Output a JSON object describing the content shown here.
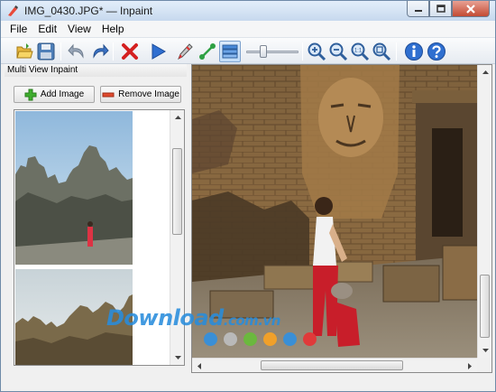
{
  "window": {
    "title": "IMG_0430.JPG* — Inpaint"
  },
  "menu": [
    "File",
    "Edit",
    "View",
    "Help"
  ],
  "toolbar": {
    "icons": [
      "open-folder-icon",
      "save-icon",
      "undo-icon",
      "redo-icon",
      "delete-icon",
      "run-icon",
      "marker-icon",
      "line-tool-icon",
      "multi-view-icon",
      "zoom-in-icon",
      "zoom-out-icon",
      "actual-size-icon",
      "fit-window-icon",
      "info-icon",
      "help-icon"
    ],
    "brush_size_fraction": 0.3
  },
  "panel": {
    "title": "Multi View Inpaint",
    "add_label": "Add Image",
    "remove_label": "Remove Image"
  },
  "watermark": {
    "text": "Download",
    "suffix": ".com.vn",
    "dot_colors": [
      "#3a8fd6",
      "#b9b9b9",
      "#6bb83e",
      "#f0a02a",
      "#3a8fd6",
      "#e03a3a"
    ]
  },
  "colors": {
    "accent": "#2f7fd1",
    "delete_red": "#d42020"
  }
}
